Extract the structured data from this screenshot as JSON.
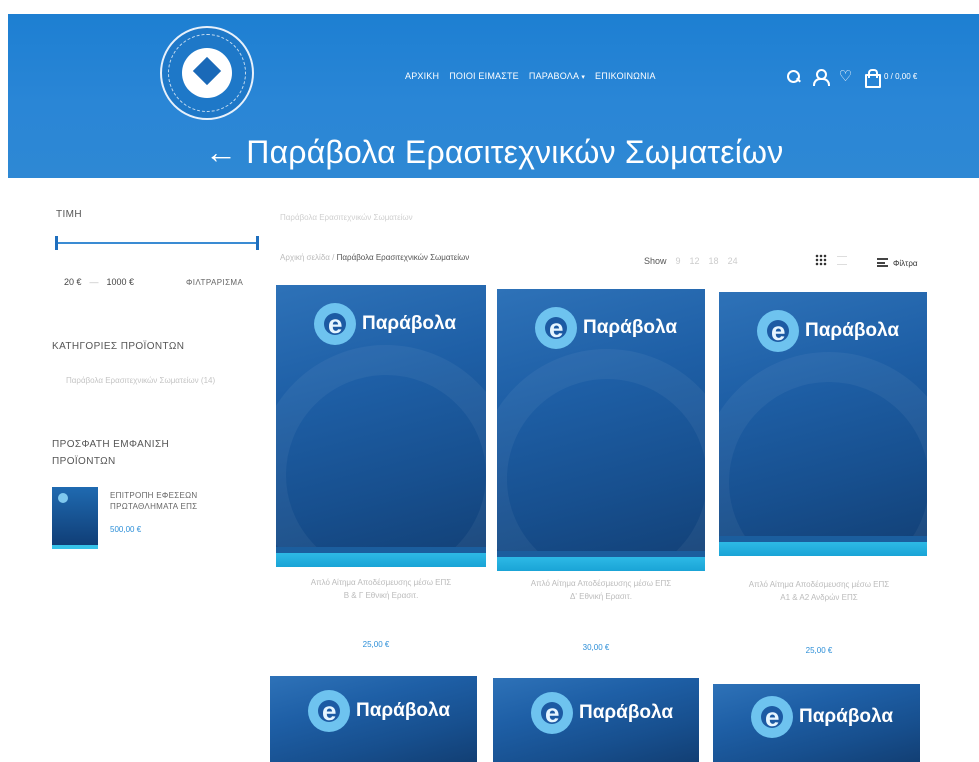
{
  "header": {
    "nav": [
      {
        "label": "ΑΡΧΙΚΗ",
        "dropdown": false
      },
      {
        "label": "ΠΟΙΟΙ ΕΙΜΑΣΤΕ",
        "dropdown": false
      },
      {
        "label": "ΠΑΡΑΒΟΛΑ",
        "dropdown": true
      },
      {
        "label": "ΕΠΙΚΟΙΝΩΝΙΑ",
        "dropdown": false
      }
    ],
    "cart_total": "0 / 0,00 €",
    "page_title": "← Παράβολα Ερασιτεχνικών Σωματείων",
    "icons": [
      "search-icon",
      "user-icon",
      "heart-icon",
      "bag-icon"
    ]
  },
  "sidebar": {
    "price_heading": "ΤΙΜΗ",
    "price_min": "20 €",
    "price_max": "1000 €",
    "price_range_sep": "—",
    "filter_button": "ΦΙΛΤΡΑΡΙΣΜΑ",
    "categories_heading": "ΚΑΤΗΓΟΡΙΕΣ ΠΡΟΪΟΝΤΩΝ",
    "category_item": "Παράβολα Ερασιτεχνικών Σωματείων (14)",
    "recent_heading_1": "ΠΡΟΣΦΑΤΗ ΕΜΦΑΝΙΣΗ",
    "recent_heading_2": "ΠΡΟΪΟΝΤΩΝ",
    "recent_item_title_1": "ΕΠΙΤΡΟΠΗ ΕΦΕΣΕΩΝ",
    "recent_item_title_2": "ΠΡΩΤΑΘΛΗΜΑΤΑ ΕΠΣ",
    "recent_item_price": "500,00 €"
  },
  "toolbar": {
    "archive_title": "Παράβολα Ερασιτεχνικών Σωματείων",
    "breadcrumb_home": "Αρχική σελίδα",
    "breadcrumb_sep": "/",
    "breadcrumb_current": "Παράβολα Ερασιτεχνικών Σωματείων",
    "show_label": "Show",
    "show_options": [
      "9",
      "12",
      "18",
      "24"
    ],
    "filter_label": "Φίλτρα"
  },
  "products": [
    {
      "brand": "Παράβολα",
      "title_1": "Απλό Αίτημα Αποδέσμευσης μέσω ΕΠΣ",
      "title_2": "Β & Γ Εθνική Ερασιτ.",
      "price": "25,00 €"
    },
    {
      "brand": "Παράβολα",
      "title_1": "Απλό Αίτημα Αποδέσμευσης μέσω ΕΠΣ",
      "title_2": "Δ' Εθνική Ερασιτ.",
      "price": "30,00 €"
    },
    {
      "brand": "Παράβολα",
      "title_1": "Απλό Αίτημα Αποδέσμευσης μέσω ΕΠΣ",
      "title_2": "Α1 & Α2 Ανδρών ΕΠΣ",
      "price": "25,00 €"
    },
    {
      "brand": "Παράβολα"
    },
    {
      "brand": "Παράβολα"
    },
    {
      "brand": "Παράβολα"
    }
  ]
}
